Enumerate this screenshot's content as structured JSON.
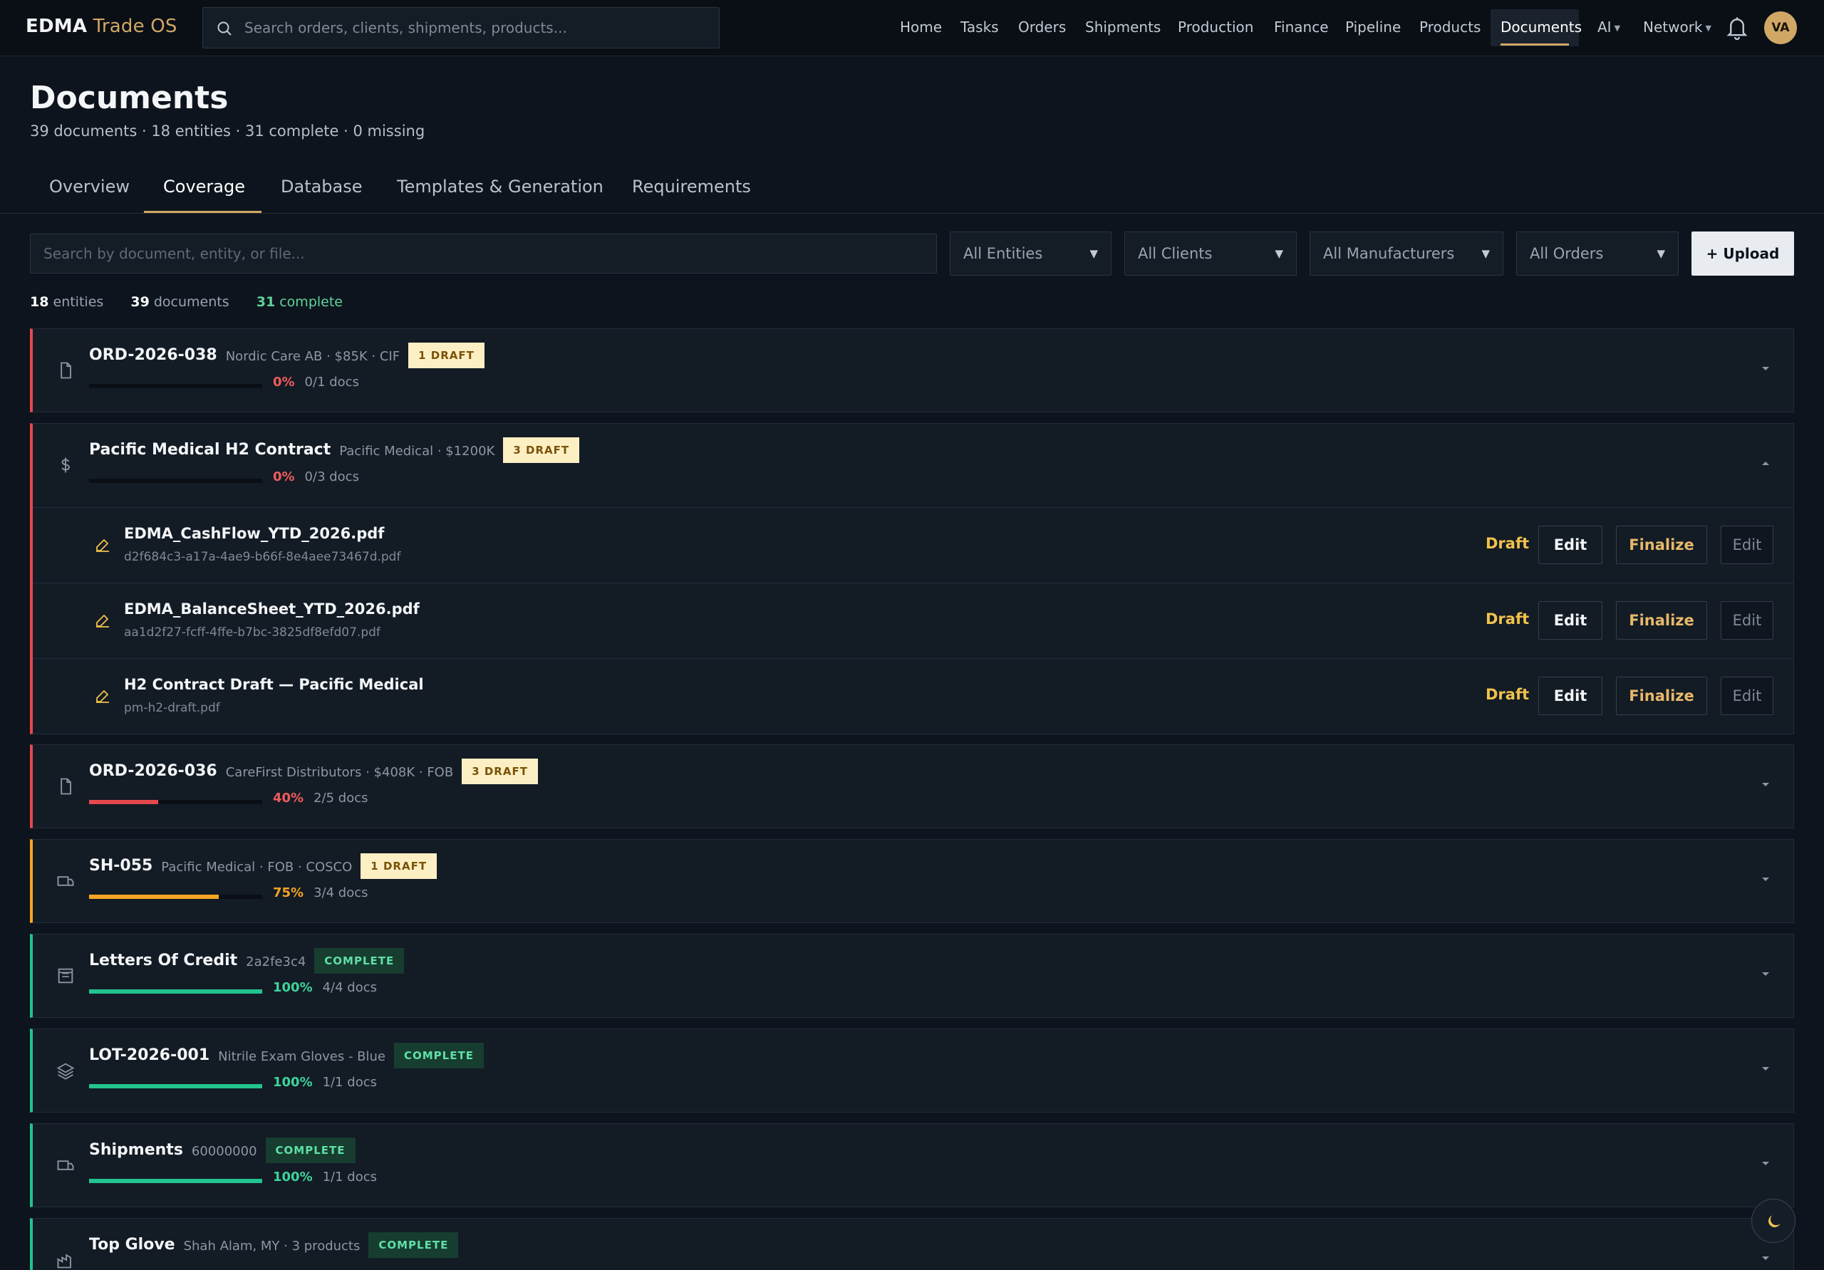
{
  "app": {
    "brand_bold": "EDMA",
    "brand_rest": "Trade OS",
    "search_placeholder": "Search orders, clients, shipments, products..."
  },
  "nav": {
    "items": [
      "Home",
      "Tasks",
      "Orders",
      "Shipments",
      "Production",
      "Finance",
      "Pipeline",
      "Products",
      "Documents",
      "AI",
      "Network"
    ],
    "active": "Documents",
    "user_initials": "VA"
  },
  "header": {
    "title": "Documents",
    "subtitle": "39 documents · 18 entities · 31 complete · 0 missing"
  },
  "tabs": {
    "items": [
      "Overview",
      "Coverage",
      "Database",
      "Templates & Generation",
      "Requirements"
    ],
    "active": "Coverage"
  },
  "toolbar": {
    "search_placeholder": "Search by document, entity, or file...",
    "filters": [
      "All Entities",
      "All Clients",
      "All Manufacturers",
      "All Orders"
    ],
    "upload_label": "+ Upload"
  },
  "stats": {
    "entities_count": "18",
    "entities_label": "entities",
    "documents_count": "39",
    "documents_label": "documents",
    "complete_count": "31",
    "complete_label": "complete"
  },
  "colors": {
    "accent": "#d1a765",
    "red": "#e5484d",
    "orange": "#f5a524",
    "green": "#22c38e",
    "draft_yellow": "#f1c24a"
  },
  "entities": [
    {
      "name": "ORD-2026-038",
      "meta": "Nordic Care AB · $85K · CIF",
      "badge": "1 DRAFT",
      "badge_type": "draft",
      "percent": "0%",
      "progress": 0,
      "docs": "0/1 docs",
      "status": "red",
      "icon": "file-icon",
      "expanded": false
    },
    {
      "name": "Pacific Medical H2 Contract",
      "meta": "Pacific Medical · $1200K",
      "badge": "3 DRAFT",
      "badge_type": "draft",
      "percent": "0%",
      "progress": 0,
      "docs": "0/3 docs",
      "status": "red",
      "icon": "dollar-icon",
      "expanded": true,
      "documents": [
        {
          "name": "EDMA_CashFlow_YTD_2026.pdf",
          "file": "d2f684c3-a17a-4ae9-b66f-8e4aee73467d.pdf",
          "status": "Draft",
          "actions": [
            "Edit",
            "Finalize",
            "Edit"
          ]
        },
        {
          "name": "EDMA_BalanceSheet_YTD_2026.pdf",
          "file": "aa1d2f27-fcff-4ffe-b7bc-3825df8efd07.pdf",
          "status": "Draft",
          "actions": [
            "Edit",
            "Finalize",
            "Edit"
          ]
        },
        {
          "name": "H2 Contract Draft — Pacific Medical",
          "file": "pm-h2-draft.pdf",
          "status": "Draft",
          "actions": [
            "Edit",
            "Finalize",
            "Edit"
          ]
        }
      ]
    },
    {
      "name": "ORD-2026-036",
      "meta": "CareFirst Distributors · $408K · FOB",
      "badge": "3 DRAFT",
      "badge_type": "draft",
      "percent": "40%",
      "progress": 0.4,
      "docs": "2/5 docs",
      "status": "red",
      "icon": "file-icon",
      "expanded": false
    },
    {
      "name": "SH-055",
      "meta": "Pacific Medical · FOB · COSCO",
      "badge": "1 DRAFT",
      "badge_type": "draft",
      "percent": "75%",
      "progress": 0.75,
      "docs": "3/4 docs",
      "status": "orange",
      "icon": "truck-icon",
      "expanded": false
    },
    {
      "name": "Letters Of Credit",
      "meta": "2a2fe3c4",
      "badge": "COMPLETE",
      "badge_type": "complete",
      "percent": "100%",
      "progress": 1,
      "docs": "4/4 docs",
      "status": "green",
      "icon": "receipt-icon",
      "expanded": false
    },
    {
      "name": "LOT-2026-001",
      "meta": "Nitrile Exam Gloves - Blue",
      "badge": "COMPLETE",
      "badge_type": "complete",
      "percent": "100%",
      "progress": 1,
      "docs": "1/1 docs",
      "status": "green",
      "icon": "layers-icon",
      "expanded": false
    },
    {
      "name": "Shipments",
      "meta": "60000000",
      "badge": "COMPLETE",
      "badge_type": "complete",
      "percent": "100%",
      "progress": 1,
      "docs": "1/1 docs",
      "status": "green",
      "icon": "truck-icon",
      "expanded": false
    },
    {
      "name": "Top Glove",
      "meta": "Shah Alam, MY · 3 products",
      "badge": "COMPLETE",
      "badge_type": "complete",
      "percent": "",
      "progress": 1,
      "docs": "",
      "status": "green",
      "icon": "factory-icon",
      "expanded": false
    }
  ]
}
